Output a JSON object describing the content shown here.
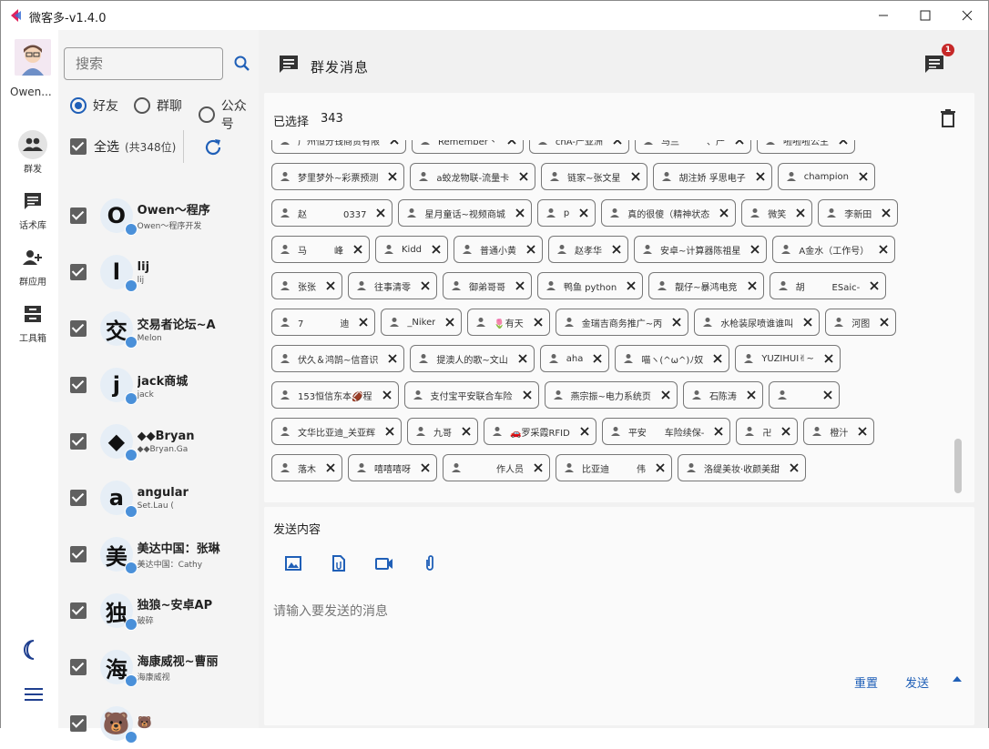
{
  "window": {
    "title": "微客多-v1.4.0"
  },
  "rail": {
    "user_name": "Owen...",
    "items": [
      {
        "label": "群发",
        "icon": "group-icon"
      },
      {
        "label": "话术库",
        "icon": "chat-lines-icon"
      },
      {
        "label": "群应用",
        "icon": "add-person-icon"
      },
      {
        "label": "工具箱",
        "icon": "inbox-icon"
      }
    ]
  },
  "list": {
    "search_placeholder": "搜索",
    "radios": [
      {
        "label": "好友",
        "checked": true
      },
      {
        "label": "群聊",
        "checked": false
      },
      {
        "label": "公众号",
        "checked": false
      }
    ],
    "select_all_label": "全选",
    "select_all_count": "(共348位)",
    "contacts": [
      {
        "avatar": "O",
        "name": "Owen～程序",
        "sub": "Owen～程序开发"
      },
      {
        "avatar": "l",
        "name": "lij",
        "sub": "lij"
      },
      {
        "avatar": "交",
        "name": "交易者论坛~A",
        "sub": "Melon"
      },
      {
        "avatar": "j",
        "name": "jack商城",
        "sub": "jack"
      },
      {
        "avatar": "◆",
        "name": "◆◆Bryan",
        "sub": "◆◆Bryan.Ga"
      },
      {
        "avatar": "a",
        "name": "angular",
        "sub": "Set.Lau ("
      },
      {
        "avatar": "美",
        "name": "美达中国：张琳",
        "sub": "美达中国：Cathy"
      },
      {
        "avatar": "独",
        "name": "独狼~安卓AP",
        "sub": "破碎"
      },
      {
        "avatar": "海",
        "name": "海康威视~曹丽",
        "sub": "海康威视"
      },
      {
        "avatar": "🐻",
        "name": "🐻",
        "sub": ""
      }
    ]
  },
  "main": {
    "header_title": "群发消息",
    "notif_count": "1",
    "selected_label": "已选择",
    "selected_count": "343",
    "chip_rows": [
      [
        "广州恒分钱商贸有限",
        "Remember丶",
        "cnA-严亚洲",
        "马兰　　　、产",
        "啦啦啦公主"
      ],
      [
        "梦里梦外~彩票预测",
        "a蛟龙物联-流量卡",
        "链家~张文星",
        "胡注娇 孚思电子",
        "champion"
      ],
      [
        "赵　　　　0337",
        "星月童话~视频商城",
        "p",
        "真的很傻（精神状态",
        "微笑",
        "李新田"
      ],
      [
        "马　　　峰",
        "Kidd",
        "普通小黄",
        "赵孝华",
        "安卓~计算器陈祖星",
        "A金水（工作号）"
      ],
      [
        "张张",
        "往事清零",
        "御弟哥哥",
        "鸭鱼 python",
        "靓仔~暴鸿电竞",
        "胡　　　ESaic-"
      ],
      [
        "7　　　　迪",
        "_Niker",
        "🌷有天",
        "金瑞吉商务推广~丙",
        "水枪装尿喷谁谁叫",
        "河图"
      ],
      [
        "伏久＆鸿鹄~信音识",
        "提澳人的歌~文山",
        "aha",
        "喵ヽ(^ω^)ﾉ奴",
        "YUZIHUI✌~"
      ],
      [
        "153恒信东本🏈程",
        "支付宝平安联合车险",
        "燕宗振~电力系统页",
        "石陈涛",
        "　　"
      ],
      [
        "文华比亚迪_关亚辉",
        "九哥",
        "🚗罗采霞RFID",
        "平安　　车险续保-",
        "卍",
        "橙汁"
      ],
      [
        "落木",
        "嘻嘻嘻呀",
        "　　　作人员",
        "比亚迪　　　伟",
        "洛缇美妆·收颜美甜"
      ]
    ],
    "send_title": "发送内容",
    "tools": [
      {
        "icon": "image-icon"
      },
      {
        "icon": "file-icon"
      },
      {
        "icon": "video-icon"
      },
      {
        "icon": "attach-icon"
      }
    ],
    "message_placeholder": "请输入要发送的消息",
    "reset_label": "重置",
    "send_label": "发送"
  }
}
